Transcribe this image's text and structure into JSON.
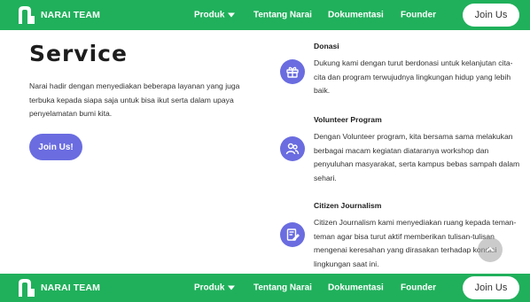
{
  "navbar": {
    "brand": "NARAI TEAM",
    "links": [
      {
        "label": "Produk",
        "dropdown": true
      },
      {
        "label": "Tentang Narai"
      },
      {
        "label": "Dokumentasi"
      },
      {
        "label": "Founder"
      }
    ],
    "join_label": "Join Us"
  },
  "hero": {
    "title": "Service",
    "description": "Narai hadir dengan menyediakan beberapa layanan yang juga terbuka kepada siapa saja untuk bisa ikut serta dalam upaya penyelamatan bumi kita.",
    "button_label": "Join Us!"
  },
  "services": [
    {
      "icon": "gift-icon",
      "title": "Donasi",
      "text": "Dukung kami dengan turut berdonasi untuk kelanjutan cita-cita dan program terwujudnya lingkungan hidup yang lebih baik."
    },
    {
      "icon": "people-icon",
      "title": "Volunteer Program",
      "text": "Dengan Volunteer program, kita bersama sama melakukan berbagai macam kegiatan diataranya workshop dan penyuluhan masyarakat, serta kampus bebas sampah dalam sehari."
    },
    {
      "icon": "edit-note-icon",
      "title": "Citizen Journalism",
      "text": "Citizen Journalism kami menyediakan ruang kepada teman-teman agar bisa turut aktif memberikan tulisan-tulisan mengenai keresahan yang dirasakan terhadap kondisi lingkungan saat ini."
    }
  ],
  "colors": {
    "nav_green": "#20b05b",
    "accent_purple": "#6a6ce0"
  }
}
